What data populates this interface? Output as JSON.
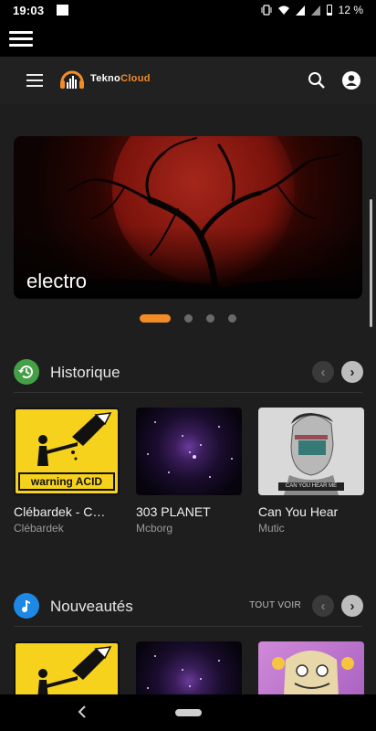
{
  "status_bar": {
    "time": "19:03",
    "battery_text": "12 %"
  },
  "app": {
    "brand_part1": "Tekno",
    "brand_part2": "Cloud",
    "accent_color": "#f28c28"
  },
  "banner": {
    "title": "electro",
    "slides_count": 4,
    "active_slide": 1
  },
  "sections": [
    {
      "title": "Historique",
      "icon": "history-icon",
      "icon_color": "#43a047",
      "see_all_label": "",
      "items": [
        {
          "title": "Clébardek - C…",
          "artist": "Clébardek",
          "cover_text": "warning  ACID"
        },
        {
          "title": "303 PLANET",
          "artist": "Mcborg"
        },
        {
          "title": "Can You Hear",
          "artist": "Mutic",
          "cover_text": "CAN YOU HEAR ME"
        }
      ]
    },
    {
      "title": "Nouveautés",
      "icon": "music-note-icon",
      "icon_color": "#1e88e5",
      "see_all_label": "TOUT VOIR",
      "items": [
        {
          "title": "",
          "artist": ""
        },
        {
          "title": "",
          "artist": ""
        },
        {
          "title": "",
          "artist": ""
        }
      ]
    }
  ]
}
